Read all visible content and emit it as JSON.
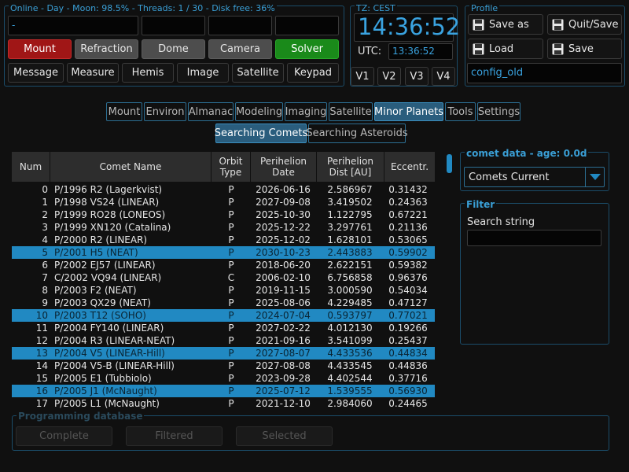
{
  "status": {
    "line": "Online - Day - Moon: 98.5% - Threads: 1 / 30 - Disk free: 36%",
    "message": "-"
  },
  "main_buttons": {
    "row1": [
      "Mount",
      "Refraction",
      "Dome",
      "Camera",
      "Solver"
    ],
    "row2": [
      "Message",
      "Measure",
      "Hemis",
      "Image",
      "Satellite",
      "Keypad"
    ]
  },
  "clock": {
    "tz_label": "TZ: CEST",
    "local_time": "14:36:52",
    "utc_label": "UTC:",
    "utc_time": "13:36:52",
    "views": [
      "V1",
      "V2",
      "V3",
      "V4"
    ]
  },
  "profile": {
    "title": "Profile",
    "save_as": "Save as",
    "quit_save": "Quit/Save",
    "load": "Load",
    "save": "Save",
    "name": "config_old"
  },
  "tabs": {
    "main": [
      "Mount",
      "Environ",
      "Almanac",
      "Modeling",
      "Imaging",
      "Satellite",
      "Minor Planets",
      "Tools",
      "Settings"
    ],
    "active": "Minor Planets",
    "sub": [
      "Searching Comets",
      "Searching Asteroids"
    ]
  },
  "table": {
    "headers": {
      "num": "Num",
      "name": "Comet Name",
      "type_1": "Orbit",
      "type_2": "Type",
      "date_1": "Perihelion",
      "date_2": "Date",
      "dist_1": "Perihelion",
      "dist_2": "Dist [AU]",
      "ecc": "Eccentr."
    },
    "rows": [
      {
        "num": "0",
        "name": "P/1996 R2 (Lagerkvist)",
        "type": "P",
        "date": "2026-06-16",
        "dist": "2.586967",
        "ecc": "0.31432"
      },
      {
        "num": "1",
        "name": "P/1998 VS24 (LINEAR)",
        "type": "P",
        "date": "2027-09-08",
        "dist": "3.419502",
        "ecc": "0.24363"
      },
      {
        "num": "2",
        "name": "P/1999 RO28 (LONEOS)",
        "type": "P",
        "date": "2025-10-30",
        "dist": "1.122795",
        "ecc": "0.67221"
      },
      {
        "num": "3",
        "name": "P/1999 XN120 (Catalina)",
        "type": "P",
        "date": "2025-12-22",
        "dist": "3.297761",
        "ecc": "0.21136"
      },
      {
        "num": "4",
        "name": "P/2000 R2 (LINEAR)",
        "type": "P",
        "date": "2025-12-02",
        "dist": "1.628101",
        "ecc": "0.53065"
      },
      {
        "num": "5",
        "name": "P/2001 H5 (NEAT)",
        "type": "P",
        "date": "2030-10-23",
        "dist": "2.443883",
        "ecc": "0.59902",
        "sel": true
      },
      {
        "num": "6",
        "name": "P/2002 EJ57 (LINEAR)",
        "type": "P",
        "date": "2018-06-20",
        "dist": "2.622151",
        "ecc": "0.59382"
      },
      {
        "num": "7",
        "name": "C/2002 VQ94 (LINEAR)",
        "type": "C",
        "date": "2006-02-10",
        "dist": "6.756858",
        "ecc": "0.96376"
      },
      {
        "num": "8",
        "name": "P/2003 F2 (NEAT)",
        "type": "P",
        "date": "2019-11-15",
        "dist": "3.000590",
        "ecc": "0.54034"
      },
      {
        "num": "9",
        "name": "P/2003 QX29 (NEAT)",
        "type": "P",
        "date": "2025-08-06",
        "dist": "4.229485",
        "ecc": "0.47127"
      },
      {
        "num": "10",
        "name": "P/2003 T12 (SOHO)",
        "type": "P",
        "date": "2024-07-04",
        "dist": "0.593797",
        "ecc": "0.77021",
        "sel": true
      },
      {
        "num": "11",
        "name": "P/2004 FY140 (LINEAR)",
        "type": "P",
        "date": "2027-02-22",
        "dist": "4.012130",
        "ecc": "0.19266"
      },
      {
        "num": "12",
        "name": "P/2004 R3 (LINEAR-NEAT)",
        "type": "P",
        "date": "2021-09-16",
        "dist": "3.541099",
        "ecc": "0.25437"
      },
      {
        "num": "13",
        "name": "P/2004 V5 (LINEAR-Hill)",
        "type": "P",
        "date": "2027-08-07",
        "dist": "4.433536",
        "ecc": "0.44834",
        "sel": true
      },
      {
        "num": "14",
        "name": "P/2004 V5-B (LINEAR-Hill)",
        "type": "P",
        "date": "2027-08-08",
        "dist": "4.433545",
        "ecc": "0.44836"
      },
      {
        "num": "15",
        "name": "P/2005 E1 (Tubbiolo)",
        "type": "P",
        "date": "2023-09-28",
        "dist": "4.402544",
        "ecc": "0.37716"
      },
      {
        "num": "16",
        "name": "P/2005 J1 (McNaught)",
        "type": "P",
        "date": "2025-07-12",
        "dist": "1.539555",
        "ecc": "0.56930",
        "sel": true
      },
      {
        "num": "17",
        "name": "P/2005 L1 (McNaught)",
        "type": "P",
        "date": "2021-12-10",
        "dist": "2.984060",
        "ecc": "0.24465"
      }
    ]
  },
  "comet_data": {
    "title": "comet data - age: 0.0d",
    "source": "Comets Current"
  },
  "filter": {
    "title": "Filter",
    "search_label": "Search string",
    "search_value": ""
  },
  "programming": {
    "title": "Programming database",
    "complete": "Complete",
    "filtered": "Filtered",
    "selected": "Selected"
  },
  "colors": {
    "accent": "#2189c2",
    "clock": "#3aa3e0",
    "mount_red": "#a01616",
    "solver_green": "#1a8a1a"
  }
}
